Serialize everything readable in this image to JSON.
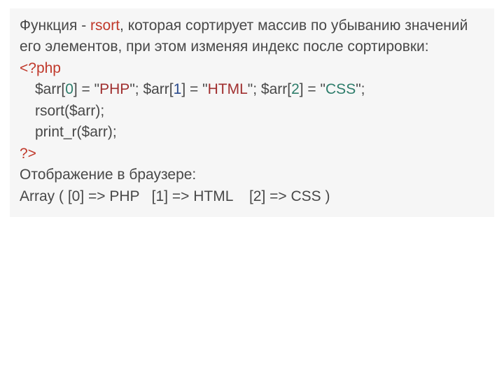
{
  "desc": {
    "p1a": "Функция - ",
    "fn": "rsort",
    "p1b": ", которая сортирует массив по убыванию значений его элементов, при этом изменяя индекс после сортировки:"
  },
  "code": {
    "open_tag": "<?php",
    "l1": {
      "a1": "$arr[",
      "i1": "0",
      "a2": "] = ",
      "s1q1": "\"",
      "s1": "PHP",
      "s1q2": "\"",
      "a3": "; $arr[",
      "i2": "1",
      "a4": "] = ",
      "s2q1": "\"",
      "s2": "HTML",
      "s2q2": "\"",
      "a5": "; $arr[",
      "i3": "2",
      "a6": "] = ",
      "s3q1": "\"",
      "s3": "CSS",
      "s3q2": "\"",
      "a7": ";"
    },
    "l2": "rsort($arr);",
    "l3": "print_r($arr);",
    "close_tag": "?>"
  },
  "output": {
    "label": "Отображение в браузере:",
    "line": "Array ( [0] => PHP   [1] => HTML    [2] => CSS )"
  }
}
